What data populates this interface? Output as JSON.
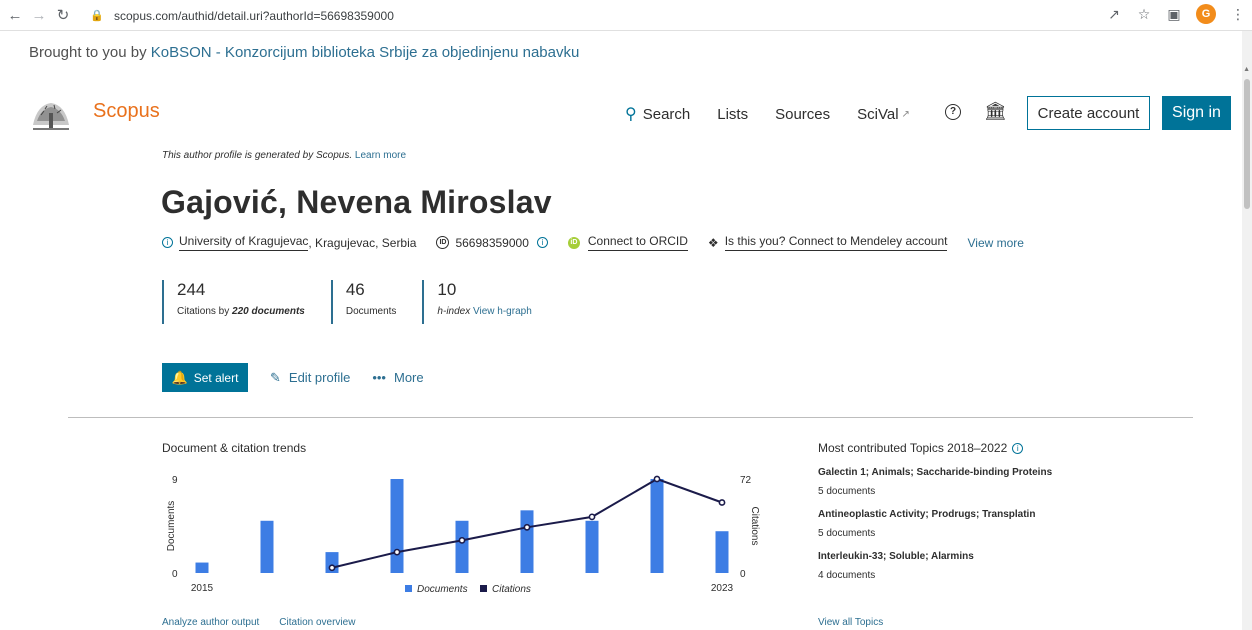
{
  "browser": {
    "url": "scopus.com/authid/detail.uri?authorId=56698359000",
    "profile_initial": "G"
  },
  "banner": {
    "prefix": "Brought to you by ",
    "link": "KoBSON - Konzorcijum biblioteka Srbije za objedinjenu nabavku"
  },
  "header": {
    "brand": "Scopus",
    "nav": [
      "Search",
      "Lists",
      "Sources",
      "SciVal"
    ],
    "create_account": "Create account",
    "sign_in": "Sign in"
  },
  "profile": {
    "generated_note": "This author profile is generated by Scopus.",
    "learn_more": "Learn more",
    "name": "Gajović, Nevena Miroslav",
    "affiliation_link": "University of Kragujevac",
    "affiliation_rest": ", Kragujevac, Serbia",
    "author_id": "56698359000",
    "orcid": "Connect to ORCID",
    "mendeley": "Is this you? Connect to Mendeley account",
    "view_more": "View more"
  },
  "metrics": {
    "citations": "244",
    "citations_label_prefix": "Citations by ",
    "citations_label_docs": "220 documents",
    "documents": "46",
    "documents_label": "Documents",
    "hindex": "10",
    "hindex_label": "h-index",
    "hgraph_link": "View h-graph"
  },
  "actions": {
    "set_alert": "Set alert",
    "edit_profile": "Edit profile",
    "more": "More"
  },
  "trends": {
    "title": "Document & citation trends",
    "analyze_link": "Analyze author output",
    "overview_link": "Citation overview"
  },
  "chart_data": {
    "type": "bar",
    "x": [
      2015,
      2016,
      2017,
      2018,
      2019,
      2020,
      2021,
      2022,
      2023
    ],
    "xticklabels": [
      "2015",
      "2023"
    ],
    "series": [
      {
        "name": "Documents",
        "type": "bar",
        "axis": "left",
        "values": [
          1,
          5,
          2,
          9,
          5,
          6,
          5,
          9,
          4
        ]
      },
      {
        "name": "Citations",
        "type": "line",
        "axis": "right",
        "values": [
          null,
          null,
          4,
          16,
          25,
          35,
          43,
          72,
          54
        ]
      }
    ],
    "ylabel_left": "Documents",
    "ylabel_right": "Citations",
    "ylim_left": [
      0,
      9
    ],
    "ylim_right": [
      0,
      72
    ],
    "legend_position": "bottom",
    "colors": {
      "Documents": "#3d7de4",
      "Citations": "#1b1b4a"
    }
  },
  "topics": {
    "title": "Most contributed Topics 2018–2022",
    "items": [
      {
        "name": "Galectin 1; Animals; Saccharide-binding Proteins",
        "count": "5 documents"
      },
      {
        "name": "Antineoplastic Activity; Prodrugs; Transplatin",
        "count": "5 documents"
      },
      {
        "name": "Interleukin-33; Soluble; Alarmins",
        "count": "4 documents"
      }
    ],
    "view_all": "View all Topics"
  },
  "colors": {
    "brand_orange": "#e9711c",
    "primary_blue": "#007398",
    "link_blue": "#2d6f91"
  }
}
